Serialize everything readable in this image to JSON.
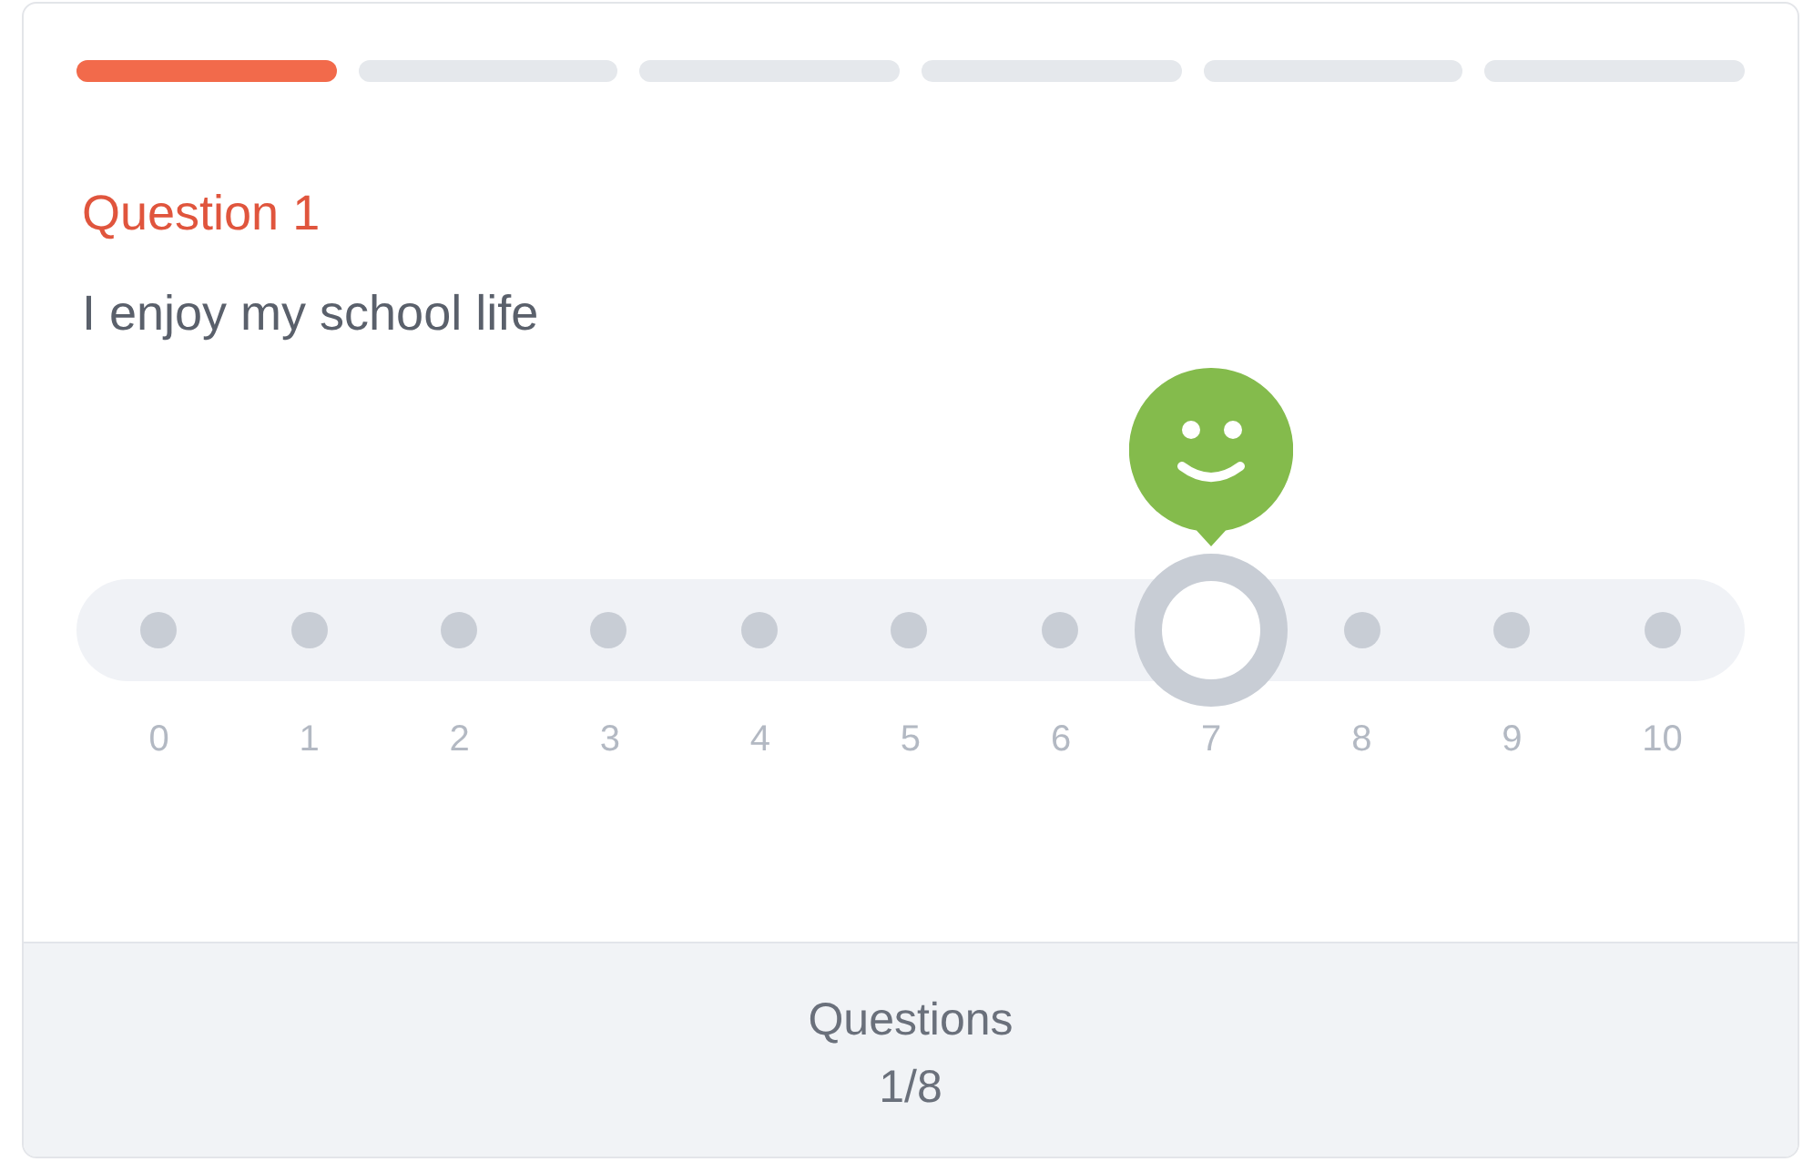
{
  "progress": [
    {
      "filled": true
    },
    {
      "filled": false
    },
    {
      "filled": false
    },
    {
      "filled": false
    },
    {
      "filled": false
    },
    {
      "filled": false
    }
  ],
  "question": {
    "title": "Question 1",
    "text": "I enjoy my school life"
  },
  "scale": {
    "options": [
      {
        "label": "0",
        "selected": false
      },
      {
        "label": "1",
        "selected": false
      },
      {
        "label": "2",
        "selected": false
      },
      {
        "label": "3",
        "selected": false
      },
      {
        "label": "4",
        "selected": false
      },
      {
        "label": "5",
        "selected": false
      },
      {
        "label": "6",
        "selected": false
      },
      {
        "label": "7",
        "selected": true
      },
      {
        "label": "8",
        "selected": false
      },
      {
        "label": "9",
        "selected": false
      },
      {
        "label": "10",
        "selected": false
      }
    ]
  },
  "footer": {
    "label": "Questions",
    "count": "1/8"
  }
}
